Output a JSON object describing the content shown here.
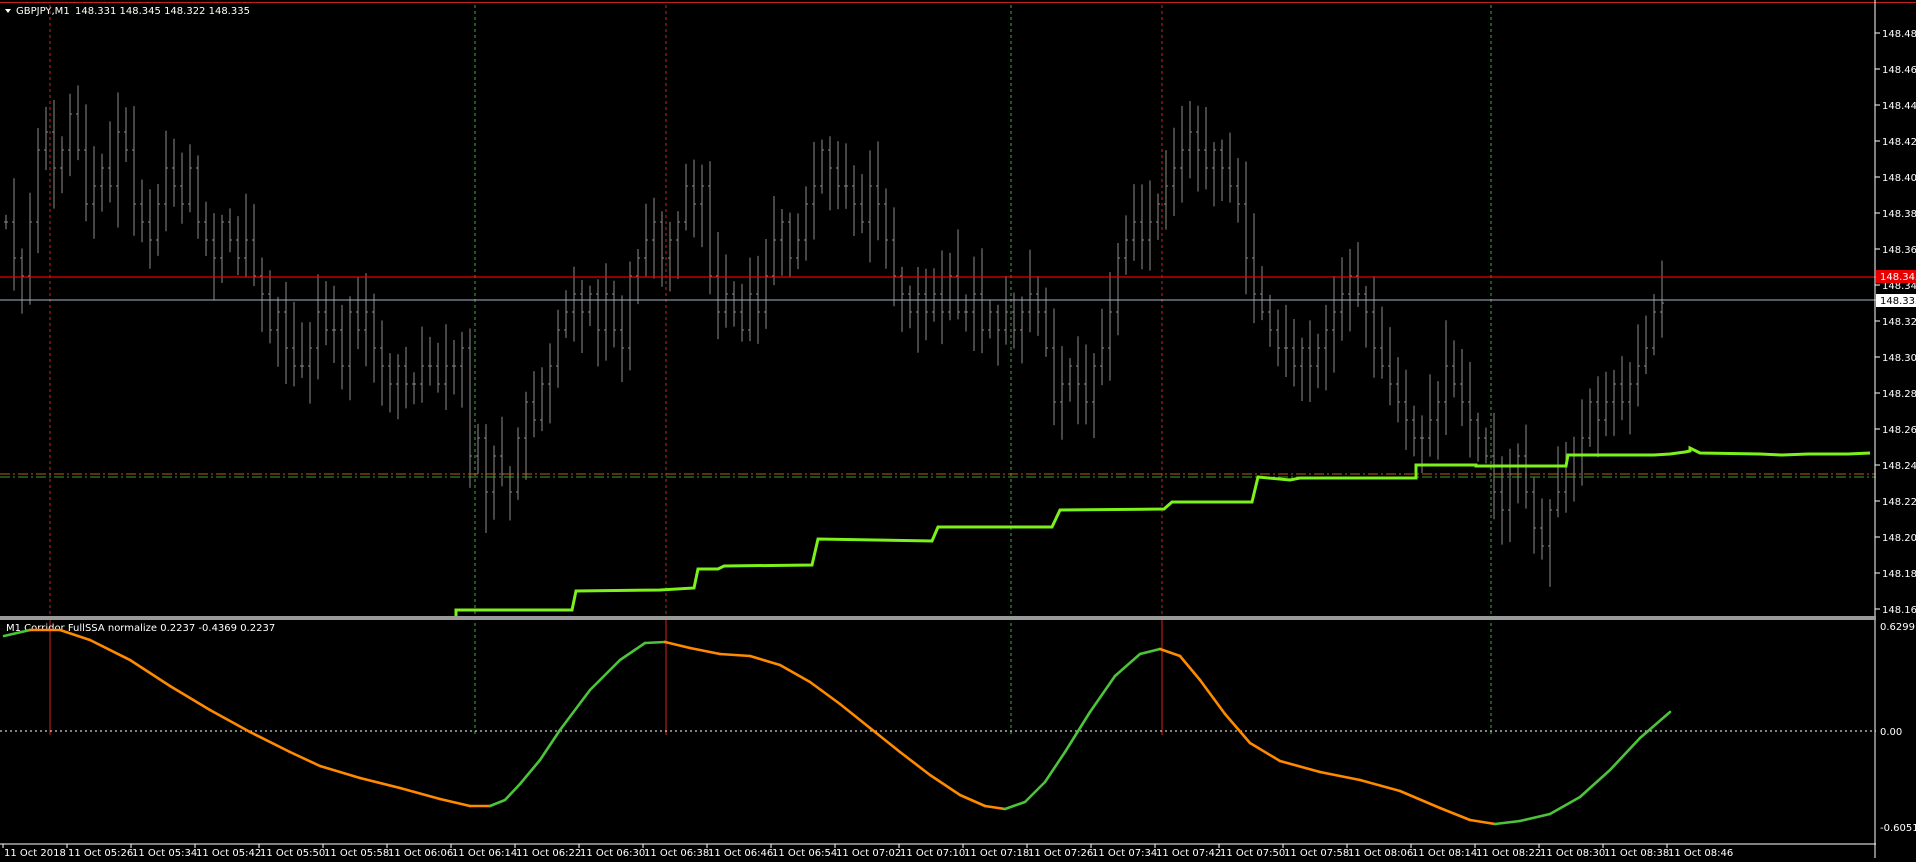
{
  "header": {
    "symbol_timeframe": "GBPJPY,M1",
    "ohlc": "148.331 148.345 148.322 148.335"
  },
  "indicator_header": "M1 Corridor FullSSA normalize 0.2237 -0.4369 0.2237",
  "colors": {
    "background": "#000000",
    "bars": "#8c8c8c",
    "price_line_red": "#e60000",
    "bid_line": "#a3b3c7",
    "step_line": "#7cf11a",
    "osc_up": "#4cc43a",
    "osc_down": "#ff8a00",
    "grid_red": "#d42020",
    "grid_green": "#2fb52f",
    "level_line": "#ffffff",
    "dashdot_orange": "#c45a1a",
    "dashdot_green": "#2fa02f"
  },
  "price_axis": {
    "ticks": [
      "148.485",
      "148.465",
      "148.445",
      "148.425",
      "148.405",
      "148.385",
      "148.365",
      "148.345",
      "148.325",
      "148.305",
      "148.285",
      "148.265",
      "148.245",
      "148.225",
      "148.205",
      "148.185",
      "148.165"
    ],
    "tag_red": "148.345",
    "tag_current": "148.335",
    "ylim": [
      148.165,
      148.485
    ]
  },
  "indicator_axis": {
    "top": "0.6299",
    "zero": "0.00",
    "bottom": "-0.6051"
  },
  "time_axis": [
    "11 Oct 2018",
    "11 Oct 05:26",
    "11 Oct 05:34",
    "11 Oct 05:42",
    "11 Oct 05:50",
    "11 Oct 05:58",
    "11 Oct 06:06",
    "11 Oct 06:14",
    "11 Oct 06:22",
    "11 Oct 06:30",
    "11 Oct 06:38",
    "11 Oct 06:46",
    "11 Oct 06:54",
    "11 Oct 07:02",
    "11 Oct 07:10",
    "11 Oct 07:18",
    "11 Oct 07:26",
    "11 Oct 07:34",
    "11 Oct 07:42",
    "11 Oct 07:50",
    "11 Oct 07:58",
    "11 Oct 08:06",
    "11 Oct 08:14",
    "11 Oct 08:22",
    "11 Oct 08:30",
    "11 Oct 08:38",
    "11 Oct 08:46"
  ],
  "chart_data": {
    "type": "line",
    "ylim": [
      148.165,
      148.485
    ],
    "horizontal_lines": [
      148.345,
      148.335,
      148.24
    ],
    "bars_close": [
      148.38,
      148.36,
      148.35,
      148.38,
      148.42,
      148.43,
      148.41,
      148.42,
      148.44,
      148.42,
      148.39,
      148.4,
      148.41,
      148.4,
      148.43,
      148.42,
      148.39,
      148.38,
      148.37,
      148.39,
      148.41,
      148.4,
      148.39,
      148.41,
      148.38,
      148.37,
      148.36,
      148.38,
      148.37,
      148.36,
      148.37,
      148.35,
      148.34,
      148.32,
      148.33,
      148.31,
      148.3,
      148.3,
      148.31,
      148.33,
      148.32,
      148.32,
      148.3,
      148.33,
      148.32,
      148.33,
      148.31,
      148.3,
      148.29,
      148.3,
      148.29,
      148.29,
      148.3,
      148.3,
      148.29,
      148.3,
      148.3,
      148.31,
      148.25,
      148.26,
      148.23,
      148.25,
      148.24,
      148.23,
      148.26,
      148.28,
      148.27,
      148.29,
      148.3,
      148.32,
      148.33,
      148.34,
      148.33,
      148.34,
      148.32,
      148.34,
      148.32,
      148.31,
      148.35,
      148.36,
      148.37,
      148.38,
      148.36,
      148.37,
      148.38,
      148.4,
      148.39,
      148.4,
      148.35,
      148.33,
      148.34,
      148.33,
      148.32,
      148.34,
      148.33,
      148.35,
      148.37,
      148.38,
      148.36,
      148.37,
      148.39,
      148.4,
      148.42,
      148.41,
      148.4,
      148.4,
      148.39,
      148.38,
      148.4,
      148.39,
      148.37,
      148.35,
      148.34,
      148.33,
      148.34,
      148.33,
      148.34,
      148.33,
      148.35,
      148.33,
      148.33,
      148.34,
      148.32,
      148.33,
      148.32,
      148.33,
      148.32,
      148.33,
      148.34,
      148.33,
      148.31,
      148.28,
      148.29,
      148.3,
      148.29,
      148.28,
      148.3,
      148.31,
      148.33,
      148.36,
      148.37,
      148.38,
      148.37,
      148.38,
      148.39,
      148.4,
      148.41,
      148.42,
      148.43,
      148.42,
      148.41,
      148.42,
      148.41,
      148.4,
      148.39,
      148.36,
      148.34,
      148.33,
      148.32,
      148.31,
      148.31,
      148.3,
      148.31,
      148.3,
      148.31,
      148.32,
      148.33,
      148.34,
      148.35,
      148.34,
      148.33,
      148.31,
      148.3,
      148.29,
      148.28,
      148.27,
      148.26,
      148.26,
      148.27,
      148.28,
      148.3,
      148.29,
      148.28,
      148.27,
      148.26,
      148.25,
      148.23,
      148.22,
      148.24,
      148.25,
      148.23,
      148.21,
      148.2,
      148.22,
      148.23,
      148.24,
      148.25,
      148.26,
      148.28,
      148.27,
      148.28,
      148.29,
      148.28,
      148.29,
      148.3,
      148.31,
      148.33,
      148.335
    ]
  }
}
